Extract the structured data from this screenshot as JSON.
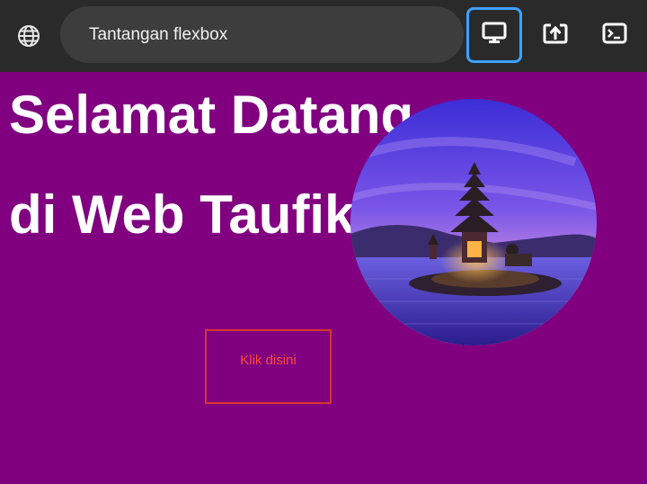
{
  "browser": {
    "title": "Tantangan flexbox",
    "icons": {
      "site": "globe-icon",
      "desktop": "monitor-icon",
      "share": "open-in-new-icon",
      "console": "terminal-icon"
    },
    "colors": {
      "toolbar_bg": "#2a2a2a",
      "pill_bg": "#3d3d3d",
      "active_border": "#3ea1ff"
    }
  },
  "page": {
    "heading_line1": "Selamat Datang",
    "heading_line2": "di Web Taufik",
    "button_label": "Klik disini",
    "colors": {
      "background": "#800080",
      "heading": "#ffffff",
      "button_text": "#ff4a3a",
      "button_border": "#d9352a"
    }
  }
}
